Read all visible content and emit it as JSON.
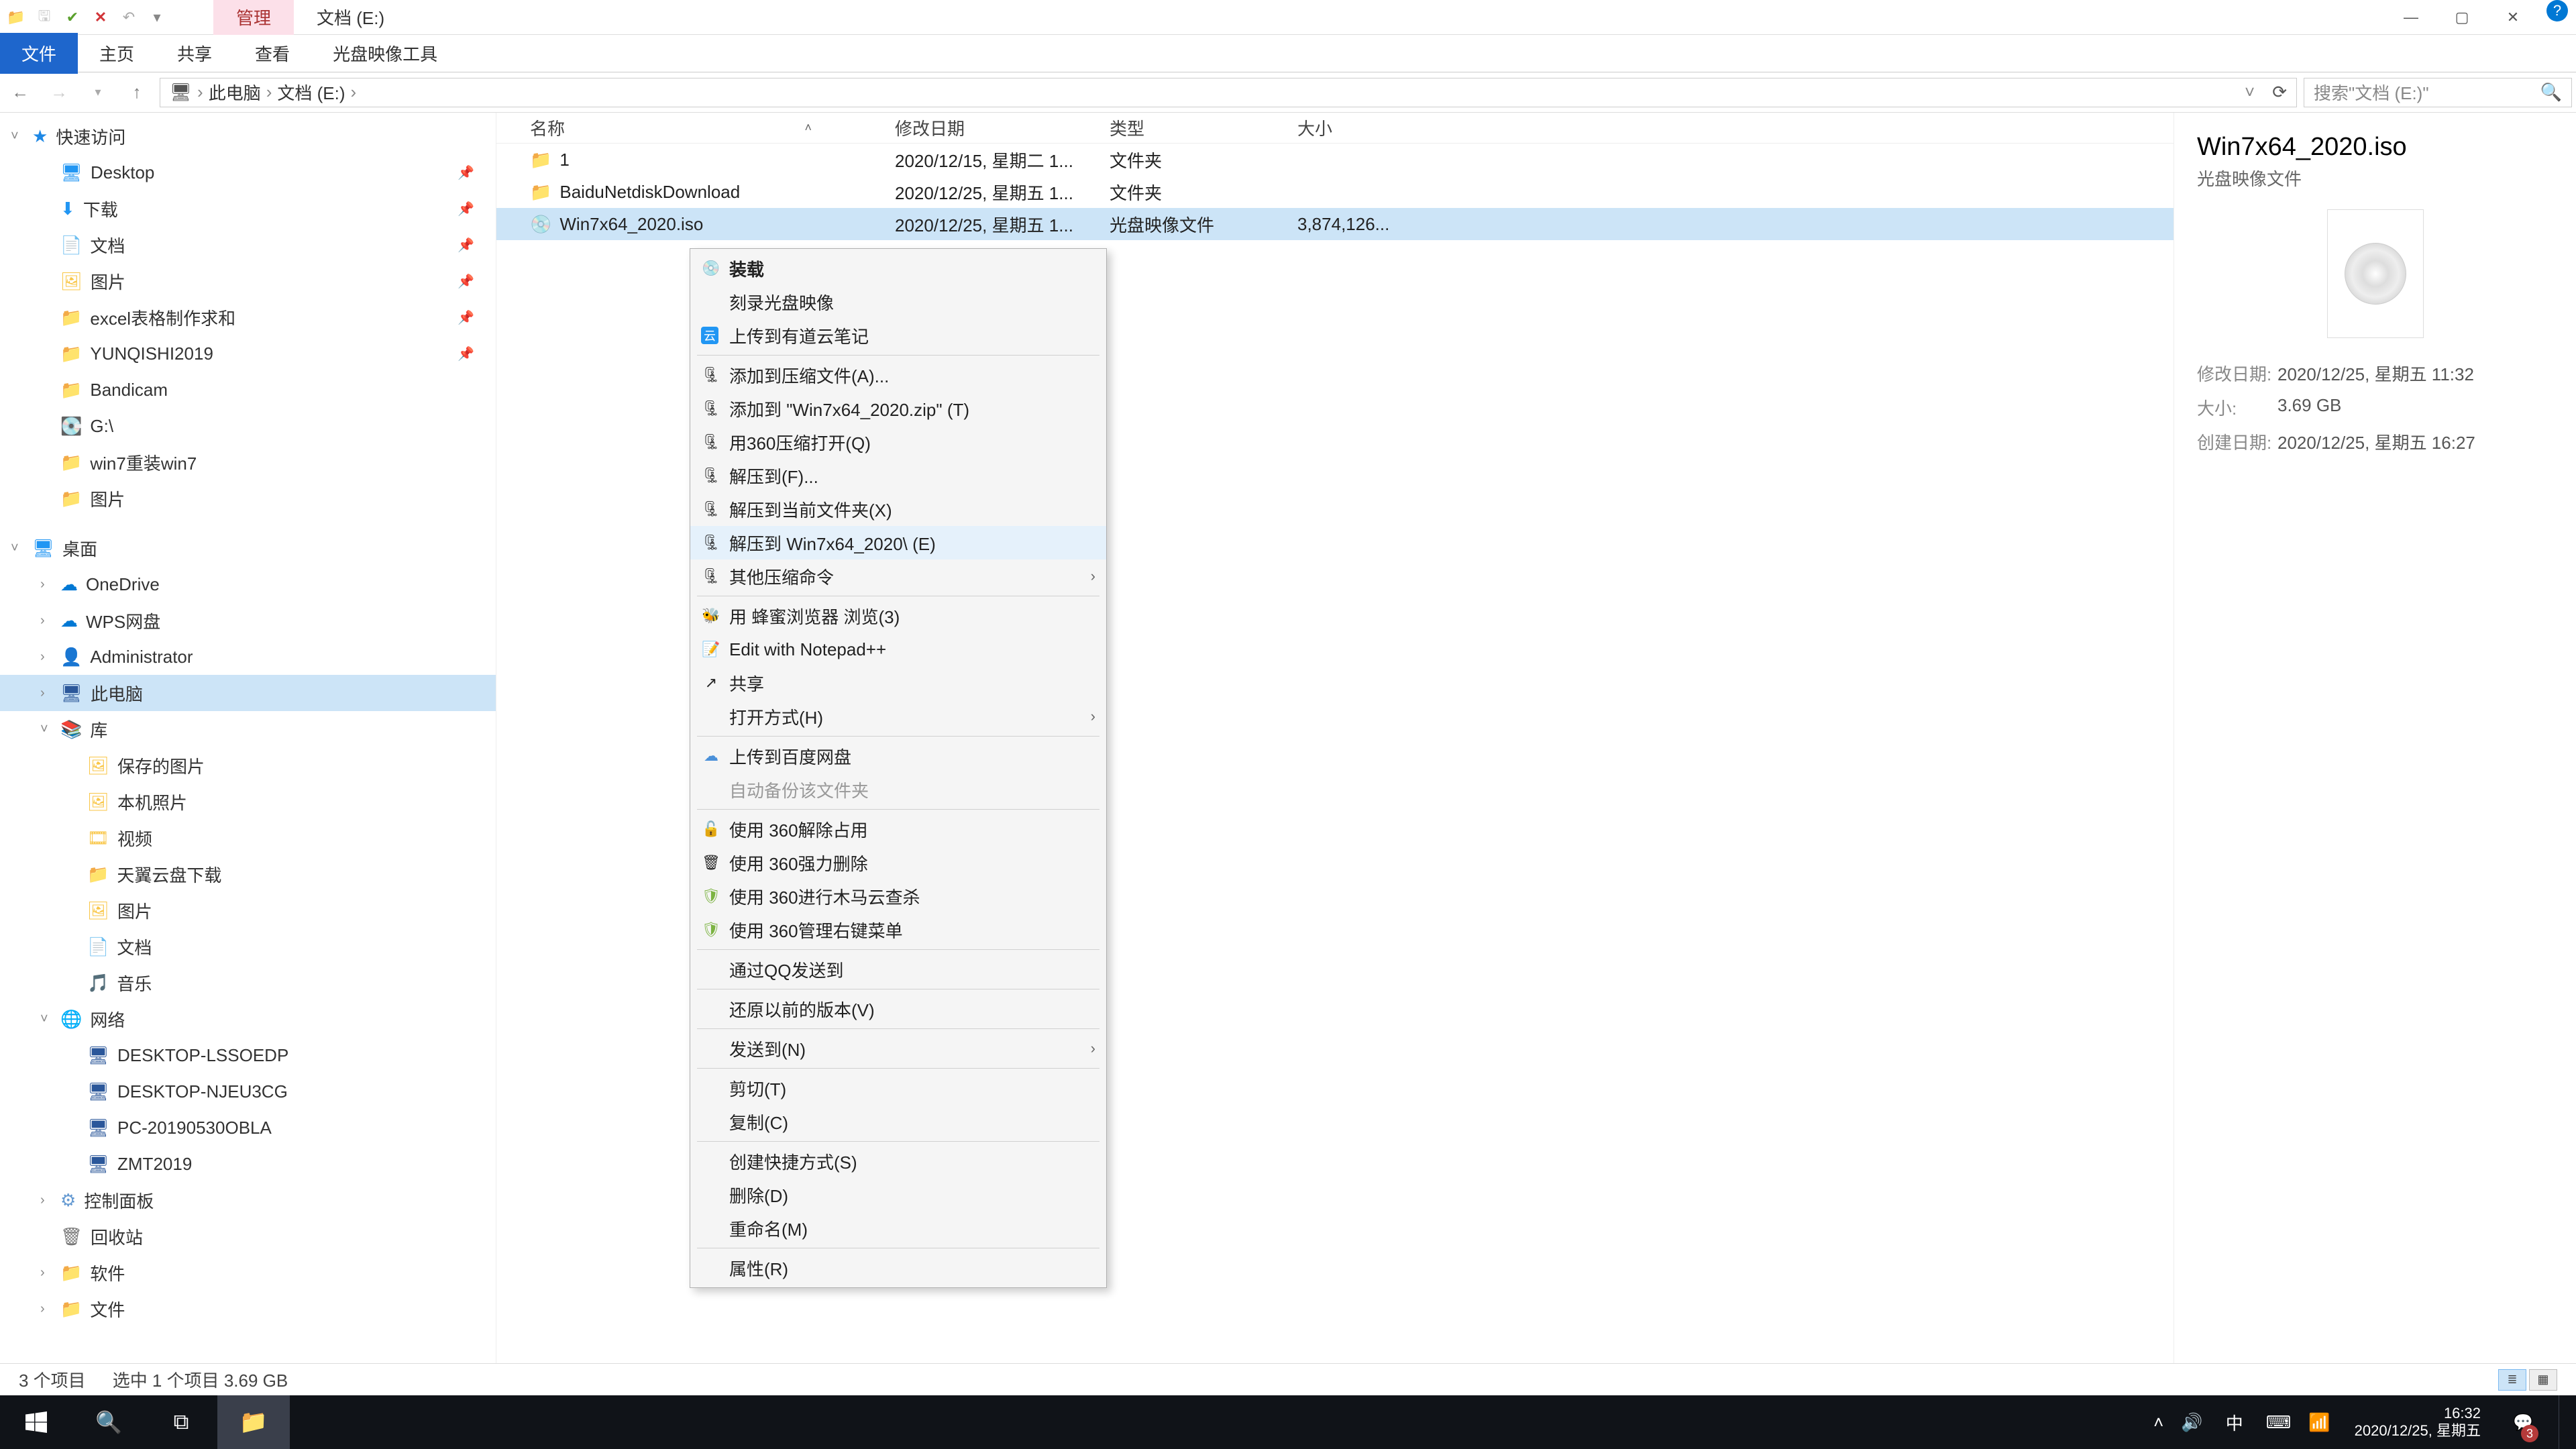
{
  "qat": {
    "save": false
  },
  "title_tabs": {
    "manage": "管理",
    "drive": "文档 (E:)"
  },
  "win": {
    "min": "—",
    "max": "▢",
    "close": "✕"
  },
  "ribbon": {
    "file": "文件",
    "home": "主页",
    "share": "共享",
    "view": "查看",
    "iso_tools": "光盘映像工具"
  },
  "breadcrumb": {
    "pc": "此电脑",
    "drive": "文档 (E:)",
    "sep": "›"
  },
  "search": {
    "placeholder": "搜索\"文档 (E:)\""
  },
  "cols": {
    "name": "名称",
    "mod": "修改日期",
    "type": "类型",
    "size": "大小"
  },
  "files": [
    {
      "name": "1",
      "mod": "2020/12/15, 星期二 1...",
      "type": "文件夹",
      "size": ""
    },
    {
      "name": "BaiduNetdiskDownload",
      "mod": "2020/12/25, 星期五 1...",
      "type": "文件夹",
      "size": ""
    },
    {
      "name": "Win7x64_2020.iso",
      "mod": "2020/12/25, 星期五 1...",
      "type": "光盘映像文件",
      "size": "3,874,126..."
    }
  ],
  "details": {
    "title": "Win7x64_2020.iso",
    "sub": "光盘映像文件",
    "mod_k": "修改日期:",
    "mod_v": "2020/12/25, 星期五 11:32",
    "size_k": "大小:",
    "size_v": "3.69 GB",
    "created_k": "创建日期:",
    "created_v": "2020/12/25, 星期五 16:27"
  },
  "tree": {
    "quick": "快速访问",
    "desktop": "Desktop",
    "downloads": "下载",
    "docs": "文档",
    "pics": "图片",
    "excel": "excel表格制作求和",
    "yunqishi": "YUNQISHI2019",
    "bandicam": "Bandicam",
    "g": "G:\\",
    "win7": "win7重装win7",
    "pics2": "图片",
    "desktop2": "桌面",
    "onedrive": "OneDrive",
    "wps": "WPS网盘",
    "admin": "Administrator",
    "thispc": "此电脑",
    "lib": "库",
    "savedpics": "保存的图片",
    "camerapics": "本机照片",
    "video": "视频",
    "tianyi": "天翼云盘下载",
    "pics3": "图片",
    "docs2": "文档",
    "music": "音乐",
    "network": "网络",
    "d1": "DESKTOP-LSSOEDP",
    "d2": "DESKTOP-NJEU3CG",
    "d3": "PC-20190530OBLA",
    "d4": "ZMT2019",
    "cp": "控制面板",
    "recycle": "回收站",
    "soft": "软件",
    "files_folder": "文件"
  },
  "ctx": {
    "mount": "装载",
    "burn": "刻录光盘映像",
    "youdao": "上传到有道云笔记",
    "addzip_a": "添加到压缩文件(A)...",
    "addzip_t": "添加到 \"Win7x64_2020.zip\" (T)",
    "open360": "用360压缩打开(Q)",
    "extract_f": "解压到(F)...",
    "extract_cur": "解压到当前文件夹(X)",
    "extract_named": "解压到 Win7x64_2020\\ (E)",
    "other_compress": "其他压缩命令",
    "bee": "用 蜂蜜浏览器 浏览(3)",
    "notepad": "Edit with Notepad++",
    "share": "共享",
    "openwith": "打开方式(H)",
    "baidu": "上传到百度网盘",
    "autobak": "自动备份该文件夹",
    "unlock360": "使用 360解除占用",
    "forcedel360": "使用 360强力删除",
    "trojan360": "使用 360进行木马云查杀",
    "manage360": "使用 360管理右键菜单",
    "qq": "通过QQ发送到",
    "restore": "还原以前的版本(V)",
    "sendto": "发送到(N)",
    "cut": "剪切(T)",
    "copy": "复制(C)",
    "shortcut": "创建快捷方式(S)",
    "delete": "删除(D)",
    "rename": "重命名(M)",
    "props": "属性(R)"
  },
  "status": {
    "count": "3 个项目",
    "sel": "选中 1 个项目  3.69 GB"
  },
  "taskbar": {
    "lang": "中",
    "time": "16:32",
    "date": "2020/12/25, 星期五",
    "badge": "3"
  }
}
